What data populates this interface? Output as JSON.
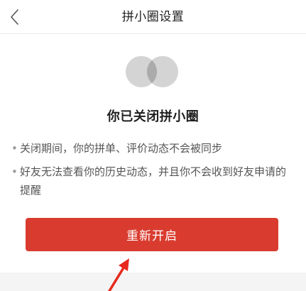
{
  "header": {
    "title": "拼小圈设置",
    "back_icon": "chevron-left-icon"
  },
  "status": {
    "icon": "overlapping-circles-icon",
    "headline": "你已关闭拼小圈"
  },
  "notes": [
    "关闭期间，你的拼单、评价动态不会被同步",
    "好友无法查看你的历史动态，并且你不会收到好友申请的提醒"
  ],
  "actions": {
    "reopen_label": "重新开启"
  },
  "colors": {
    "primary": "#d93c2f",
    "annotation_arrow": "#e8281d",
    "circle_light": "#d0d0d0",
    "circle_overlap": "#a9a9a9"
  }
}
